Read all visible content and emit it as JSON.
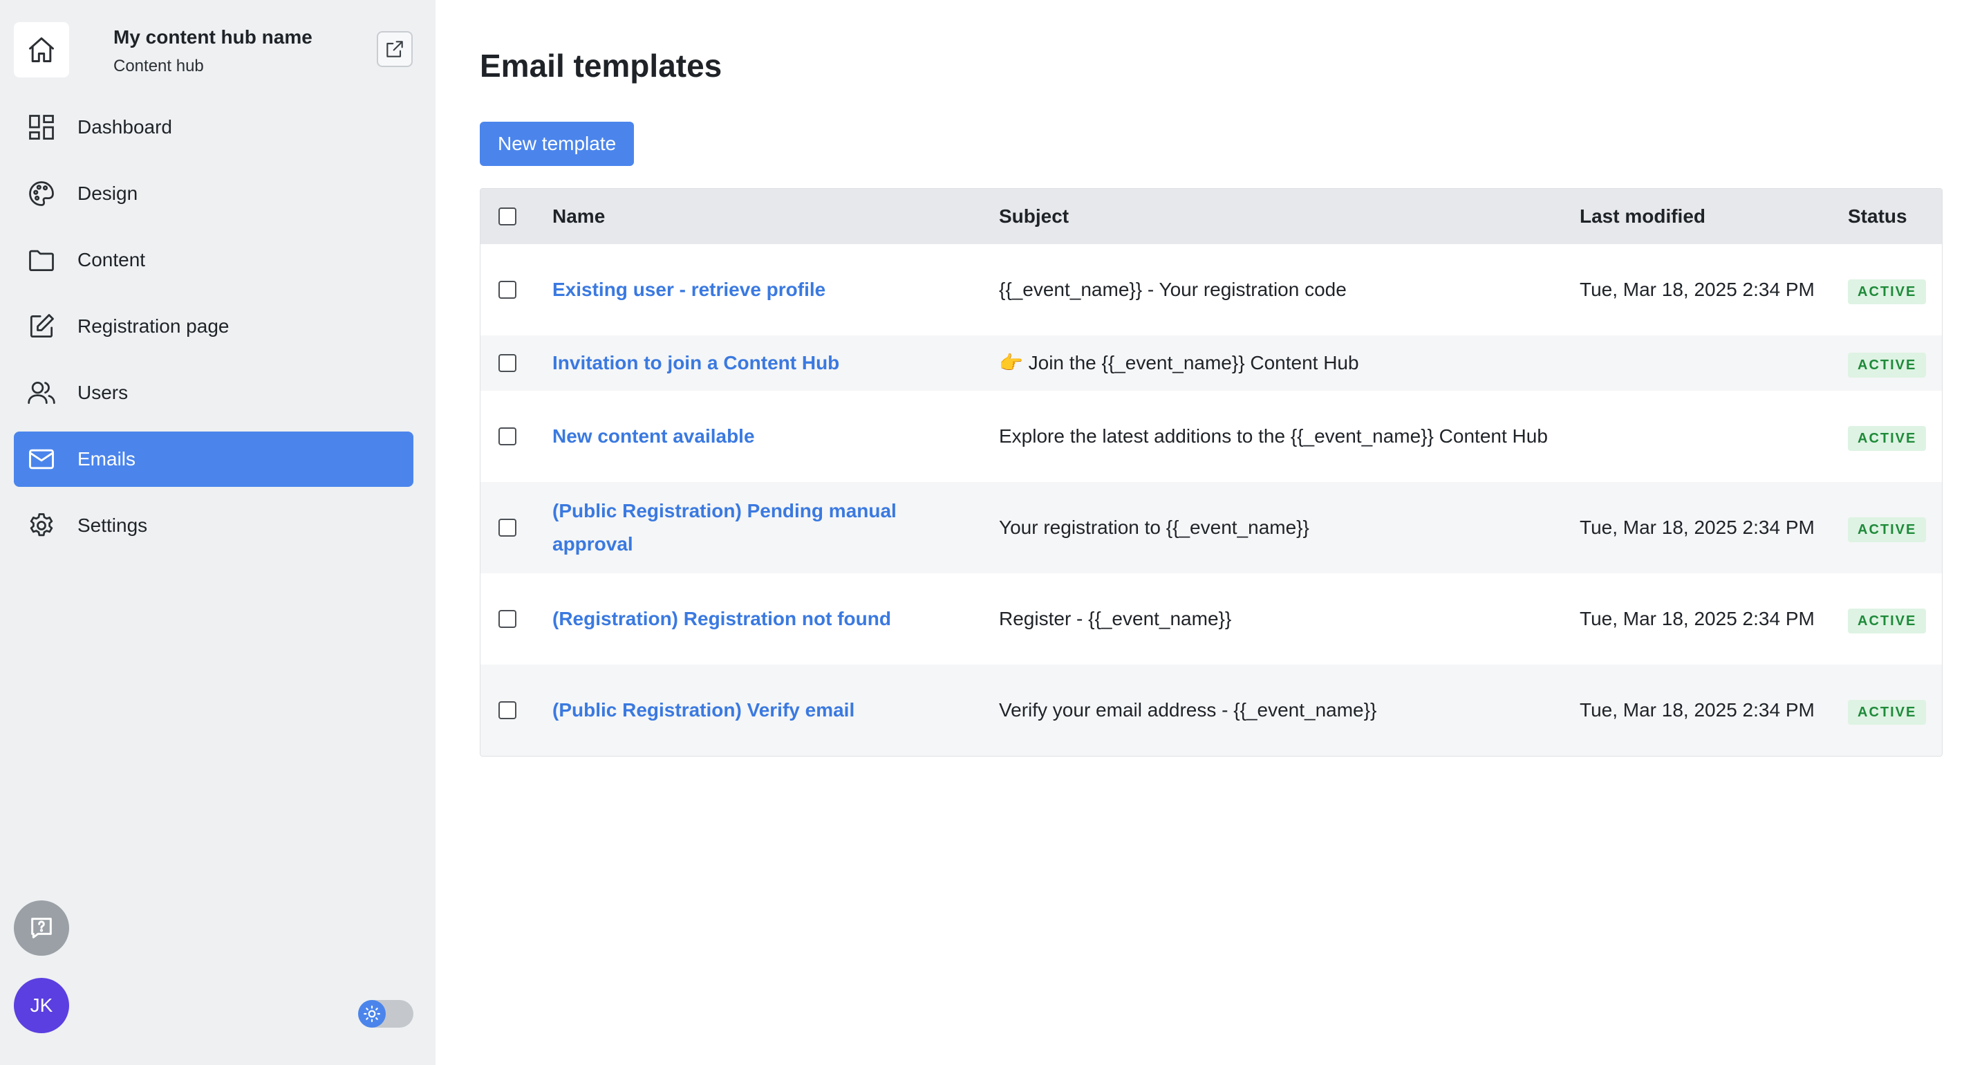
{
  "sidebar": {
    "hub_name": "My content hub name",
    "hub_subtitle": "Content hub",
    "items": [
      {
        "label": "Dashboard",
        "icon": "dashboard-icon",
        "active": false
      },
      {
        "label": "Design",
        "icon": "palette-icon",
        "active": false
      },
      {
        "label": "Content",
        "icon": "folder-icon",
        "active": false
      },
      {
        "label": "Registration page",
        "icon": "edit-icon",
        "active": false
      },
      {
        "label": "Users",
        "icon": "users-icon",
        "active": false
      },
      {
        "label": "Emails",
        "icon": "mail-icon",
        "active": true
      },
      {
        "label": "Settings",
        "icon": "gear-icon",
        "active": false
      }
    ],
    "avatar_initials": "JK"
  },
  "main": {
    "title": "Email templates",
    "new_button_label": "New template",
    "table": {
      "headers": {
        "name": "Name",
        "subject": "Subject",
        "last_modified": "Last modified",
        "status": "Status"
      },
      "rows": [
        {
          "name": "Existing user - retrieve profile",
          "subject": "{{_event_name}} - Your registration code",
          "last_modified": "Tue, Mar 18, 2025 2:34 PM",
          "status": "ACTIVE"
        },
        {
          "name": "Invitation to join a Content Hub",
          "subject": "👉 Join the {{_event_name}} Content Hub",
          "last_modified": "",
          "status": "ACTIVE"
        },
        {
          "name": "New content available",
          "subject": "Explore the latest additions to the {{_event_name}} Content Hub",
          "last_modified": "",
          "status": "ACTIVE"
        },
        {
          "name": "(Public Registration) Pending manual approval",
          "subject": "Your registration to {{_event_name}}",
          "last_modified": "Tue, Mar 18, 2025 2:34 PM",
          "status": "ACTIVE"
        },
        {
          "name": "(Registration) Registration not found",
          "subject": "Register - {{_event_name}}",
          "last_modified": "Tue, Mar 18, 2025 2:34 PM",
          "status": "ACTIVE"
        },
        {
          "name": "(Public Registration) Verify email",
          "subject": "Verify your email address - {{_event_name}}",
          "last_modified": "Tue, Mar 18, 2025 2:34 PM",
          "status": "ACTIVE"
        }
      ]
    }
  },
  "colors": {
    "accent": "#4b85ec",
    "link": "#3a79e0",
    "sidebar_bg": "#eef0f2",
    "badge_bg": "#def3e3",
    "badge_text": "#1e8a3a",
    "avatar_bg": "#5b3fe0"
  }
}
